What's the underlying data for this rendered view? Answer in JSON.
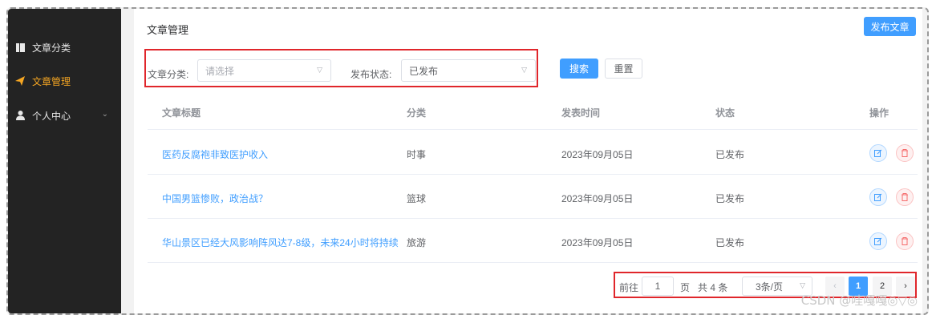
{
  "sidebar": {
    "items": [
      {
        "label": "文章分类",
        "icon": "document-icon",
        "active": false
      },
      {
        "label": "文章管理",
        "icon": "plane-icon",
        "active": true
      },
      {
        "label": "个人中心",
        "icon": "user-icon",
        "active": false,
        "expandable": true
      }
    ]
  },
  "header": {
    "title": "文章管理",
    "publish_button": "发布文章"
  },
  "filters": {
    "category_label": "文章分类:",
    "category_placeholder": "请选择",
    "status_label": "发布状态:",
    "status_value": "已发布",
    "search_button": "搜索",
    "reset_button": "重置"
  },
  "table": {
    "columns": [
      "文章标题",
      "分类",
      "发表时间",
      "状态",
      "操作"
    ],
    "rows": [
      {
        "title": "医药反腐袍非致医护收入",
        "category": "时事",
        "date": "2023年09月05日",
        "status": "已发布"
      },
      {
        "title": "中国男篮惨败，政治战？",
        "category": "篮球",
        "date": "2023年09月05日",
        "status": "已发布"
      },
      {
        "title": "华山景区已经大风影响阵风达7-8级，未来24小时将持续",
        "category": "旅游",
        "date": "2023年09月05日",
        "status": "已发布"
      }
    ]
  },
  "pagination": {
    "goto_prefix": "前往",
    "goto_value": "1",
    "goto_suffix": "页",
    "total_text": "共 4 条",
    "page_size": "3条/页",
    "prev": "‹",
    "current_page": "1",
    "next_page": "2",
    "next": "›"
  },
  "watermark": "CSDN @哇嘎嘎◎▽◎",
  "colors": {
    "primary": "#409eff",
    "sidebar_bg": "#232323",
    "active_menu": "#f5a623",
    "annotation_red": "#e0262b"
  }
}
